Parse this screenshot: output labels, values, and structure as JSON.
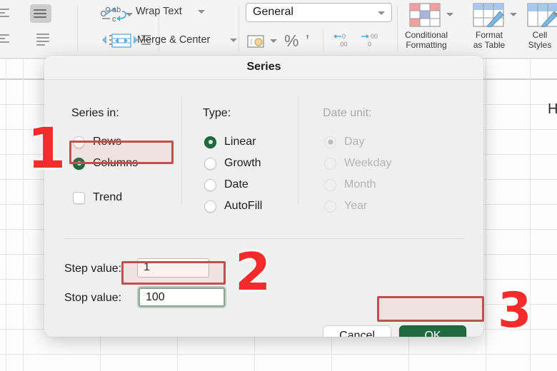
{
  "ribbon": {
    "wrap_text_label": "Wrap Text",
    "merge_center_label": "Merge & Center",
    "number_format_value": "General",
    "conditional_formatting_label_line1": "Conditional",
    "conditional_formatting_label_line2": "Formatting",
    "format_as_table_label_line1": "Format",
    "format_as_table_label_line2": "as Table",
    "cell_styles_label_line1": "Cell",
    "cell_styles_label_line2": "Styles",
    "percent_symbol": "%",
    "comma_symbol": "’",
    "decimal_decrease": "←0\n.00",
    "decimal_increase": ".00\n→0"
  },
  "sheet": {
    "visible_cell_text": "H"
  },
  "dialog": {
    "title": "Series",
    "series_in": {
      "title": "Series in:",
      "options": [
        {
          "label": "Rows",
          "selected": false
        },
        {
          "label": "Columns",
          "selected": true
        }
      ],
      "trend": {
        "label": "Trend",
        "checked": false
      }
    },
    "type": {
      "title": "Type:",
      "options": [
        {
          "label": "Linear",
          "selected": true
        },
        {
          "label": "Growth",
          "selected": false
        },
        {
          "label": "Date",
          "selected": false
        },
        {
          "label": "AutoFill",
          "selected": false
        }
      ]
    },
    "date_unit": {
      "title": "Date unit:",
      "disabled": true,
      "options": [
        {
          "label": "Day",
          "selected": true
        },
        {
          "label": "Weekday",
          "selected": false
        },
        {
          "label": "Month",
          "selected": false
        },
        {
          "label": "Year",
          "selected": false
        }
      ]
    },
    "step_value": {
      "label": "Step value:",
      "value": "1",
      "placeholder": ""
    },
    "stop_value": {
      "label": "Stop value:",
      "value": "100",
      "placeholder": "",
      "focused": true
    },
    "buttons": {
      "cancel_label": "Cancel",
      "ok_label": "OK"
    }
  },
  "annotations": {
    "step1": "1",
    "step2": "2",
    "step3": "3",
    "color": "#f42b2b",
    "box_color": "#c0504d"
  }
}
